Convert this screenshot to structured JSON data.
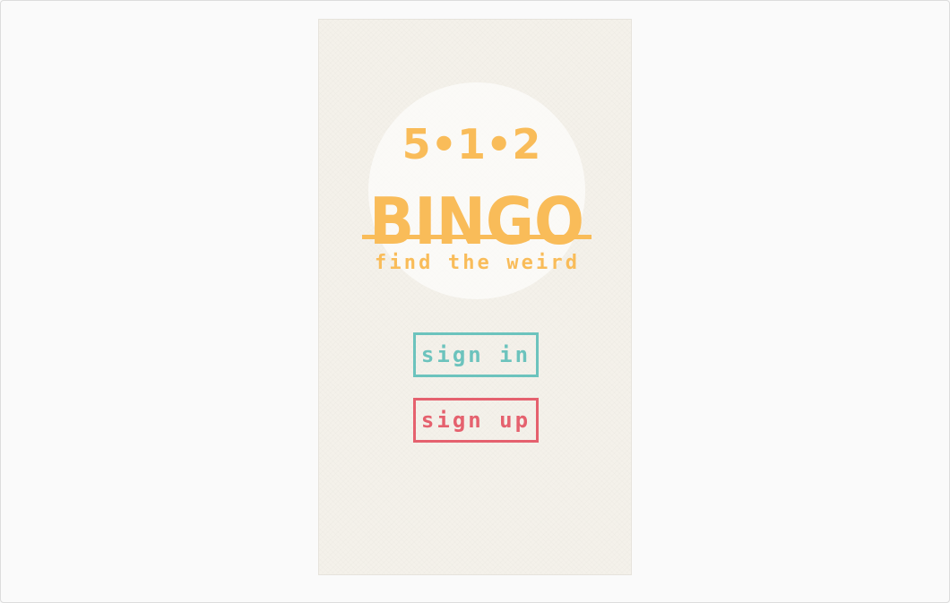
{
  "app": {
    "logo_number": "5•1•2",
    "logo_title": "BINGO",
    "tagline": "find the weird"
  },
  "buttons": {
    "sign_in": "sign in",
    "sign_up": "sign up"
  },
  "colors": {
    "logo": "#f9bc59",
    "sign_in": "#6cc3bd",
    "sign_up": "#e5616e",
    "background": "#f4f1ea"
  }
}
